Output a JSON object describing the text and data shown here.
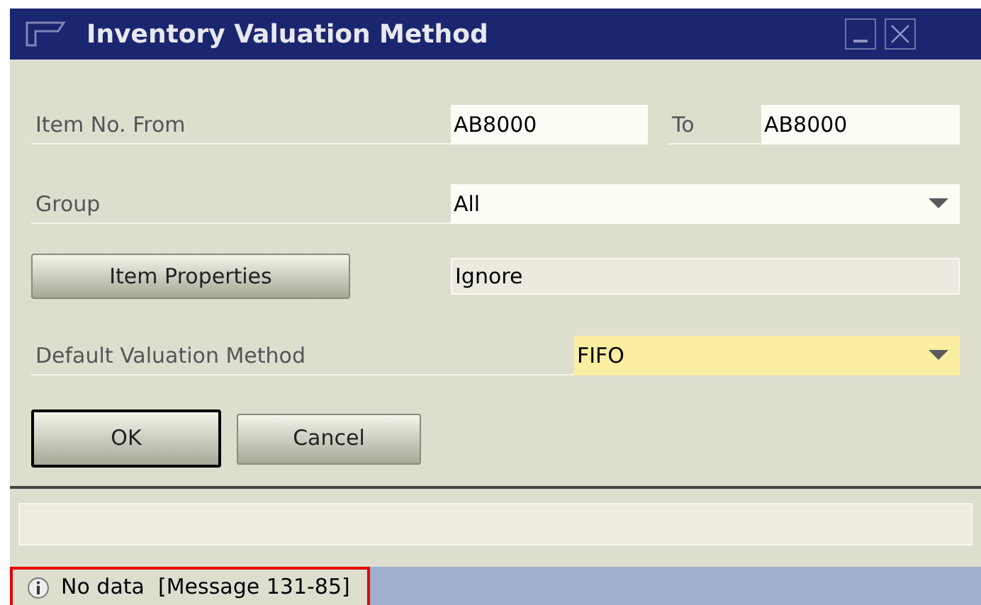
{
  "window": {
    "title": "Inventory Valuation Method"
  },
  "form": {
    "item_from_label": "Item No. From",
    "item_from_value": "AB8000",
    "item_to_label": "To",
    "item_to_value": "AB8000",
    "group_label": "Group",
    "group_value": "All",
    "properties_button": "Item Properties",
    "properties_value": "Ignore",
    "method_label": "Default Valuation Method",
    "method_value": "FIFO"
  },
  "buttons": [
    {
      "label": "OK",
      "default": true
    },
    {
      "label": "Cancel",
      "default": false
    }
  ],
  "status_bar": {
    "message": "No data  [Message 131-85]"
  }
}
